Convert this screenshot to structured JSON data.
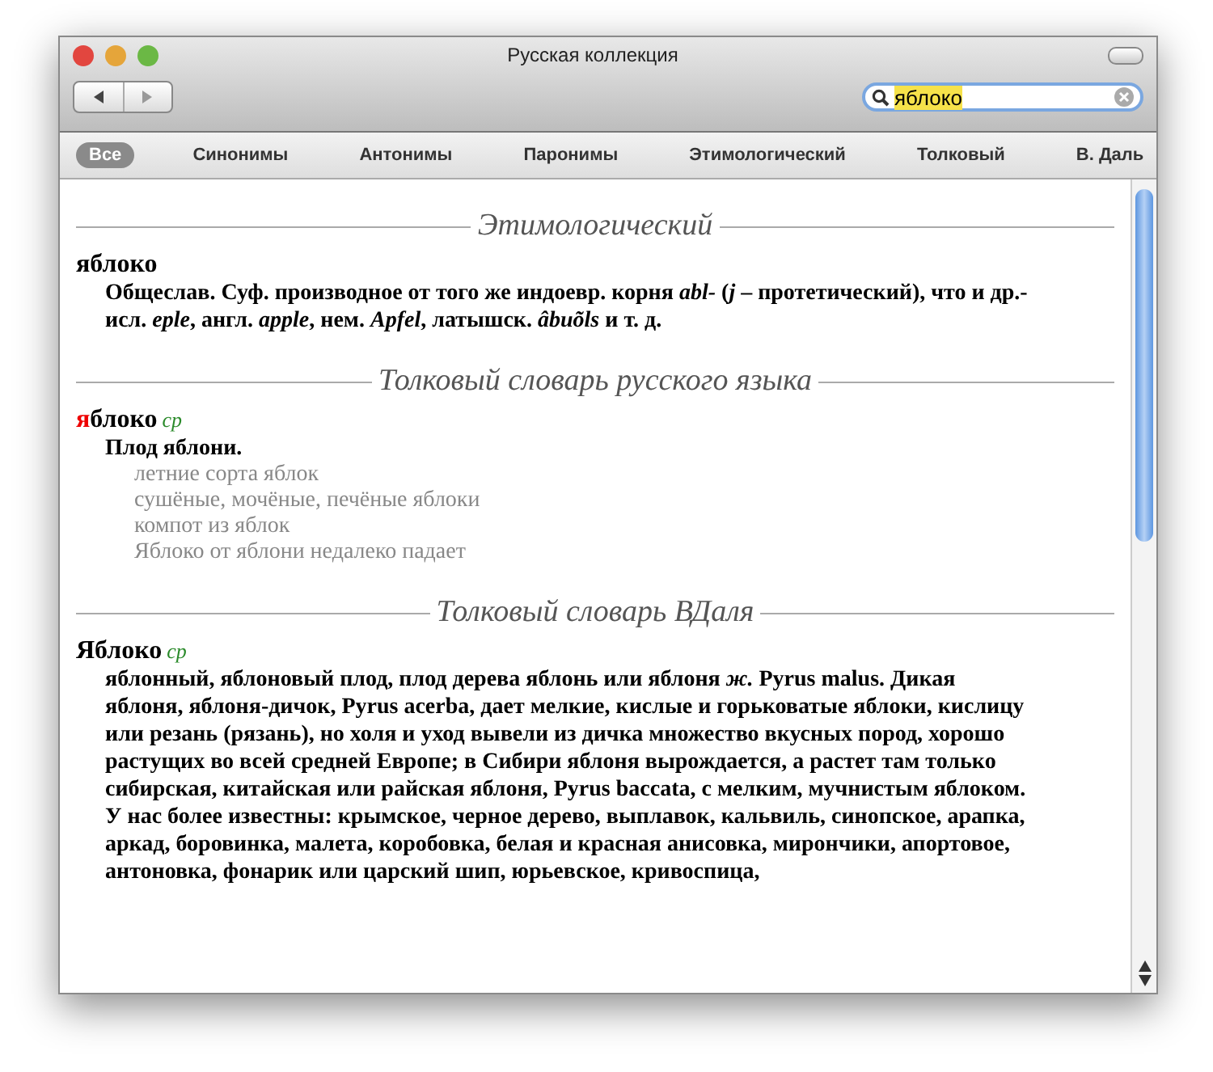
{
  "window": {
    "title": "Русская коллекция"
  },
  "search": {
    "value": "яблоко"
  },
  "scopes": [
    {
      "label": "Все",
      "selected": true
    },
    {
      "label": "Синонимы",
      "selected": false
    },
    {
      "label": "Антонимы",
      "selected": false
    },
    {
      "label": "Паронимы",
      "selected": false
    },
    {
      "label": "Этимологический",
      "selected": false
    },
    {
      "label": "Толковый",
      "selected": false
    },
    {
      "label": "В. Даль",
      "selected": false
    }
  ],
  "sections": [
    {
      "heading": "Этимологический",
      "headword": [
        {
          "text": "яблоко",
          "highlighted": false
        }
      ],
      "definition": "Общеслав. Суф. производное от того же индоевр. корня *abl-* (*j* – протетический), что и др.-исл. *eple*, англ. *apple*, нем. *Apfel*, латышск. *âbuõls* и т. д."
    },
    {
      "heading": "Толковый словарь русского языка",
      "headword": [
        {
          "text": "я",
          "highlighted": true
        },
        {
          "text": "блоко",
          "highlighted": false
        }
      ],
      "grammar": "ср",
      "definition": "Плод яблони.",
      "examples": [
        "летние сорта яблок",
        "сушёные, мочёные, печёные яблоки",
        "компот из яблок",
        "Яблоко от яблони недалеко падает"
      ]
    },
    {
      "heading": "Толковый словарь ВДаля",
      "headword": [
        {
          "text": "Яблоко",
          "highlighted": false
        }
      ],
      "grammar": "ср",
      "definition": "яблонный, яблоновый плод, плод дерева яблонь или яблоня *ж.* Pyrus malus. Дикая яблоня, яблоня-дичок, Pyrus acerba, дает мелкие, кислые и горьковатые яблоки, кислицу или резань (рязань), но холя и уход вывели из дичка множество вкусных пород, хорошо растущих во всей средней Европе; в Сибири яблоня вырождается, а растет там только сибирская, китайская или райская яблоня, Pyrus baccata, с мелким, мучнистым яблоком. У нас более известны: крымское, черное дерево, выплавок, кальвиль, синопское, арапка, аркад, боровинка, малета, коробовка, белая и красная анисовка, мирончики, апортовое, антоновка, фонарик или царский шип, юрьевское, кривоспица,"
    }
  ]
}
